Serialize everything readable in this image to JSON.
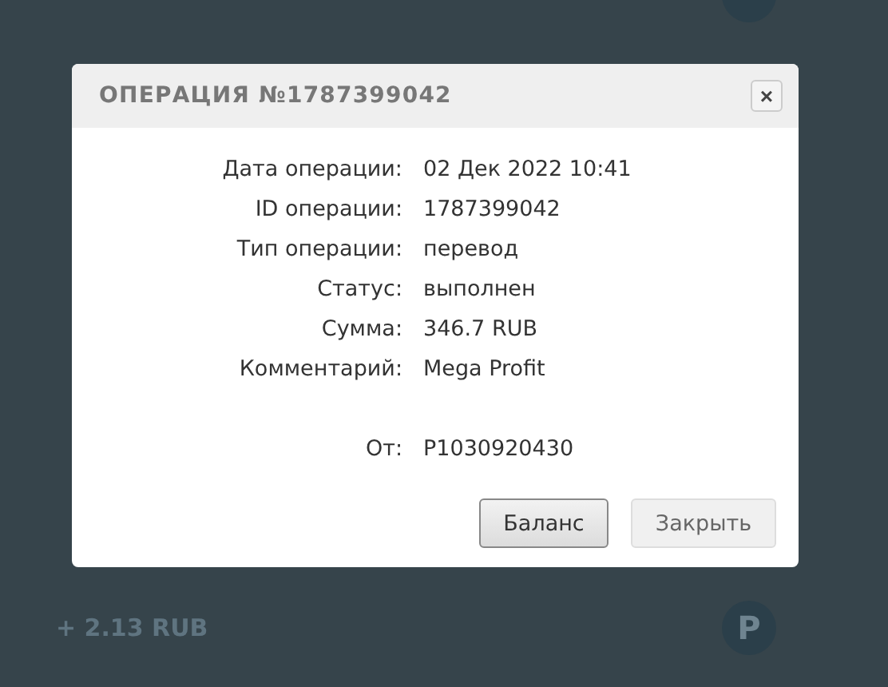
{
  "background": {
    "rows": [
      {
        "amount": "+ 2.13 RUB",
        "currency_icon": "Р"
      }
    ]
  },
  "dialog": {
    "title": "ОПЕРАЦИЯ №1787399042",
    "close": "×",
    "fields": [
      {
        "label": "Дата операции:",
        "value": "02 Дек 2022 10:41"
      },
      {
        "label": "ID операции:",
        "value": "1787399042"
      },
      {
        "label": "Тип операции:",
        "value": "перевод"
      },
      {
        "label": "Статус:",
        "value": "выполнен"
      },
      {
        "label": "Сумма:",
        "value": "346.7 RUB"
      },
      {
        "label": "Комментарий:",
        "value": "Mega Profit"
      }
    ],
    "sender": {
      "label": "От:",
      "value": "P1030920430"
    },
    "buttons": [
      {
        "label": "Баланс",
        "kind": "primary"
      },
      {
        "label": "Закрыть",
        "kind": "secondary"
      }
    ]
  }
}
